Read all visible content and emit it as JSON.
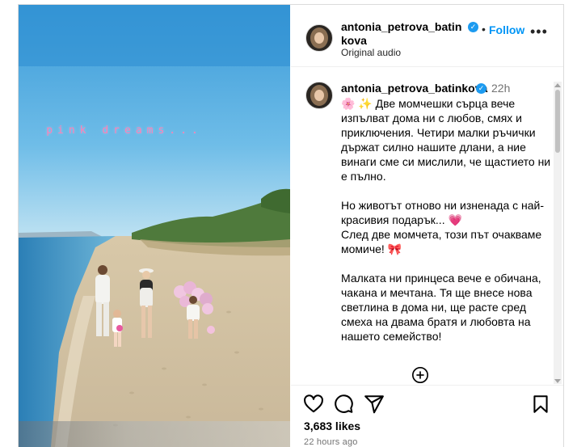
{
  "media": {
    "overlay_text": "pink dreams..."
  },
  "header": {
    "username": "antonia_petrova_batinkova",
    "verified_symbol": "✓",
    "separator": "•",
    "follow_label": "Follow",
    "more_symbol": "•••",
    "audio_label": "Original audio"
  },
  "caption": {
    "username": "antonia_petrova_batinkova",
    "verified_symbol": "✓",
    "time": "22h",
    "emoji_flower": "🌸",
    "emoji_sparkles": "✨",
    "paragraph1": " Две момчешки сърца вече изпълват дома ни с любов, смях и приключения. Четири малки ръчички държат силно нашите длани, а ние винаги сме си мислили, че щастието ни е пълно.",
    "paragraph2_a": "Но животът отново ни изненада с най-красивия подарък... ",
    "emoji_heart": "💗",
    "paragraph2_b": "След две момчета, този път очакваме момиче! ",
    "emoji_bow": "🎀",
    "paragraph3": "Малката ни принцеса вече е обичана, чакана и мечтана. Тя ще внесе нова светлина в дома ни, ще расте сред смеха на двама братя и любовта на нашето семейство!",
    "load_more_icon": "plus-circle-icon"
  },
  "actions": {
    "like_icon": "heart-icon",
    "comment_icon": "comment-icon",
    "share_icon": "share-icon",
    "save_icon": "bookmark-icon",
    "likes": "3,683 likes",
    "time_ago": "22 hours ago"
  }
}
